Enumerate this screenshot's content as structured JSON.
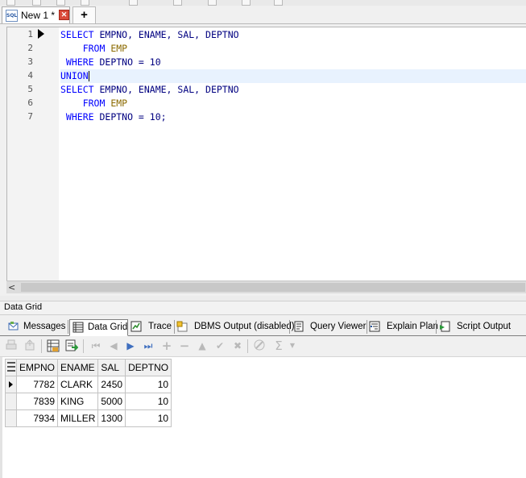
{
  "tabs": {
    "active_label": "New 1 *",
    "add_label": "+",
    "sql_icon_text": "SQL"
  },
  "editor": {
    "line_numbers": [
      "1",
      "2",
      "3",
      "4",
      "5",
      "6",
      "7"
    ],
    "lines": [
      [
        {
          "t": "SELECT ",
          "c": "kw"
        },
        {
          "t": "EMPNO, ENAME, SAL, DEPTNO",
          "c": ""
        }
      ],
      [
        {
          "t": "    FROM ",
          "c": "kw"
        },
        {
          "t": "EMP",
          "c": "obj"
        }
      ],
      [
        {
          "t": " WHERE ",
          "c": "kw"
        },
        {
          "t": "DEPTNO = 10",
          "c": ""
        }
      ],
      [
        {
          "t": "UNION",
          "c": "kw"
        }
      ],
      [
        {
          "t": "SELECT ",
          "c": "kw"
        },
        {
          "t": "EMPNO, ENAME, SAL, DEPTNO",
          "c": ""
        }
      ],
      [
        {
          "t": "    FROM ",
          "c": "kw"
        },
        {
          "t": "EMP",
          "c": "obj"
        }
      ],
      [
        {
          "t": " WHERE ",
          "c": "kw"
        },
        {
          "t": "DEPTNO = 10;",
          "c": ""
        }
      ]
    ],
    "current_line": 4
  },
  "scrollbar": {
    "left_arrow": "<"
  },
  "panel": {
    "title": "Data Grid"
  },
  "result_tabs": [
    {
      "label": "Messages",
      "icon": "messages-icon",
      "active": false
    },
    {
      "label": "Data Grid",
      "icon": "data-grid-icon",
      "active": true
    },
    {
      "label": "Trace",
      "icon": "trace-icon",
      "active": false
    },
    {
      "label": "DBMS Output (disabled)",
      "icon": "dbms-output-icon",
      "active": false
    },
    {
      "label": "Query Viewer",
      "icon": "query-viewer-icon",
      "active": false
    },
    {
      "label": "Explain Plan",
      "icon": "explain-plan-icon",
      "active": false
    },
    {
      "label": "Script Output",
      "icon": "script-output-icon",
      "active": false
    }
  ],
  "grid_toolbar": {
    "nav_first": "⏮",
    "nav_prev": "◀",
    "nav_next": "▶",
    "nav_last": "⏭",
    "insert": "+",
    "delete": "−",
    "edit": "▲",
    "post": "✔",
    "cancel": "✖",
    "sum": "Σ"
  },
  "grid": {
    "columns": [
      "EMPNO",
      "ENAME",
      "SAL",
      "DEPTNO"
    ],
    "rows": [
      [
        "7782",
        "CLARK",
        "2450",
        "10"
      ],
      [
        "7839",
        "KING",
        "5000",
        "10"
      ],
      [
        "7934",
        "MILLER",
        "1300",
        "10"
      ]
    ],
    "current_row": 0
  }
}
